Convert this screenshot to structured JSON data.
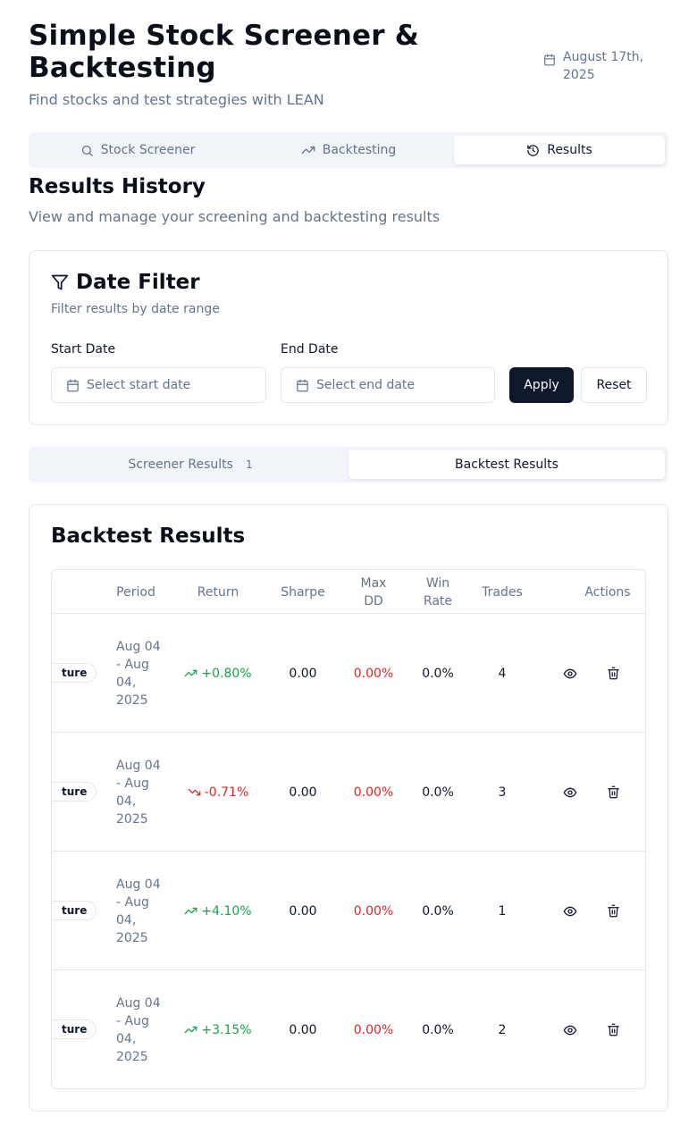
{
  "header": {
    "title": "Simple Stock Screener & Backtesting",
    "subtitle": "Find stocks and test strategies with LEAN",
    "date": "August 17th, 2025"
  },
  "main_tabs": [
    {
      "label": "Stock Screener",
      "icon": "search-icon"
    },
    {
      "label": "Backtesting",
      "icon": "trending-up-icon"
    },
    {
      "label": "Results",
      "icon": "history-icon",
      "active": true
    }
  ],
  "results_section": {
    "title": "Results History",
    "description": "View and manage your screening and backtesting results"
  },
  "date_filter": {
    "title": "Date Filter",
    "description": "Filter results by date range",
    "start_label": "Start Date",
    "start_placeholder": "Select start date",
    "end_label": "End Date",
    "end_placeholder": "Select end date",
    "apply_label": "Apply",
    "reset_label": "Reset"
  },
  "sub_tabs": [
    {
      "label": "Screener Results",
      "count": "1"
    },
    {
      "label": "Backtest Results",
      "active": true
    }
  ],
  "backtest": {
    "title": "Backtest Results",
    "columns": {
      "period": "Period",
      "return": "Return",
      "sharpe": "Sharpe",
      "max_dd": "Max DD",
      "win_rate": "Win Rate",
      "trades": "Trades",
      "actions": "Actions"
    },
    "rows": [
      {
        "strategy": "ture",
        "period": "Aug 04 - Aug 04, 2025",
        "return": "+0.80%",
        "direction": "up",
        "sharpe": "0.00",
        "max_dd": "0.00%",
        "win_rate": "0.0%",
        "trades": "4"
      },
      {
        "strategy": "ture",
        "period": "Aug 04 - Aug 04, 2025",
        "return": "-0.71%",
        "direction": "down",
        "sharpe": "0.00",
        "max_dd": "0.00%",
        "win_rate": "0.0%",
        "trades": "3"
      },
      {
        "strategy": "ture",
        "period": "Aug 04 - Aug 04, 2025",
        "return": "+4.10%",
        "direction": "up",
        "sharpe": "0.00",
        "max_dd": "0.00%",
        "win_rate": "0.0%",
        "trades": "1"
      },
      {
        "strategy": "ture",
        "period": "Aug 04 - Aug 04, 2025",
        "return": "+3.15%",
        "direction": "up",
        "sharpe": "0.00",
        "max_dd": "0.00%",
        "win_rate": "0.0%",
        "trades": "2"
      }
    ]
  },
  "colors": {
    "positive": "#16a34a",
    "negative": "#dc2626",
    "primary": "#0f172a",
    "muted": "#64748b"
  }
}
